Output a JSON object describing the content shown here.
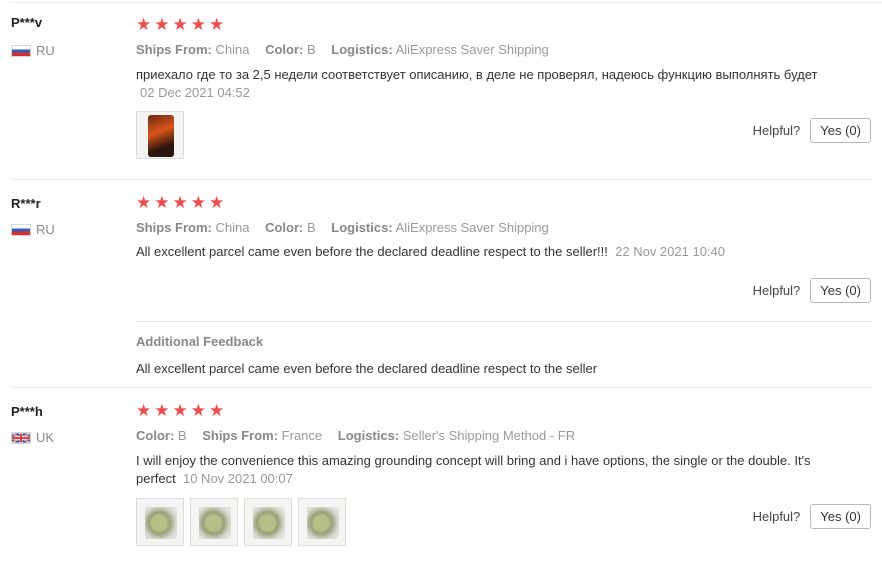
{
  "reviews": [
    {
      "user": "P***v",
      "country": "RU",
      "stars": 5,
      "meta": [
        {
          "key": "Ships From:",
          "value": "China"
        },
        {
          "key": "Color:",
          "value": "B"
        },
        {
          "key": "Logistics:",
          "value": "AliExpress Saver Shipping"
        }
      ],
      "text": "приехало где то за 2,5 недели соответствует описанию, в деле не проверял, надеюсь функцию выполнять будет",
      "date": "02 Dec 2021 04:52",
      "helpful_label": "Helpful?",
      "yes_label": "Yes (0)"
    },
    {
      "user": "R***r",
      "country": "RU",
      "stars": 5,
      "meta": [
        {
          "key": "Ships From:",
          "value": "China"
        },
        {
          "key": "Color:",
          "value": "B"
        },
        {
          "key": "Logistics:",
          "value": "AliExpress Saver Shipping"
        }
      ],
      "text": "All excellent parcel came even before the declared deadline respect to the seller!!!",
      "date": "22 Nov 2021 10:40",
      "helpful_label": "Helpful?",
      "yes_label": "Yes (0)",
      "additional_title": "Additional Feedback",
      "additional_text": "All excellent parcel came even before the declared deadline respect to the seller"
    },
    {
      "user": "P***h",
      "country": "UK",
      "stars": 5,
      "meta": [
        {
          "key": "Color:",
          "value": "B"
        },
        {
          "key": "Ships From:",
          "value": "France"
        },
        {
          "key": "Logistics:",
          "value": "Seller's Shipping Method - FR"
        }
      ],
      "text": "I will enjoy the convenience this amazing grounding concept will bring and i have options, the single or the double. It's perfect",
      "date": "10 Nov 2021 00:07",
      "helpful_label": "Helpful?",
      "yes_label": "Yes (0)"
    }
  ]
}
